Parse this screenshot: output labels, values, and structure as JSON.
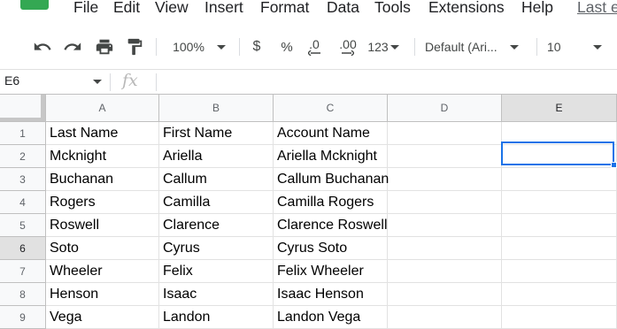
{
  "menu": {
    "items": [
      "File",
      "Edit",
      "View",
      "Insert",
      "Format",
      "Data",
      "Tools",
      "Extensions",
      "Help"
    ],
    "last_edit": "Last e"
  },
  "toolbar": {
    "zoom": "100%",
    "currency": "$",
    "percent": "%",
    "decrease_decimal": ".0",
    "increase_decimal": ".00",
    "number_format": "123",
    "font": "Default (Ari...",
    "font_size": "10"
  },
  "formula_bar": {
    "cell_ref": "E6",
    "fx": "fx",
    "value": ""
  },
  "grid": {
    "columns": [
      "A",
      "B",
      "C",
      "D",
      "E"
    ],
    "selected_column": "E",
    "selected_row": "6",
    "rows": [
      {
        "num": "1",
        "cells": [
          "Last Name",
          "First Name",
          "Account Name",
          "",
          ""
        ]
      },
      {
        "num": "2",
        "cells": [
          "Mcknight",
          "Ariella",
          "Ariella Mcknight",
          "",
          ""
        ]
      },
      {
        "num": "3",
        "cells": [
          "Buchanan",
          "Callum",
          "Callum Buchanan",
          "",
          ""
        ]
      },
      {
        "num": "4",
        "cells": [
          "Rogers",
          "Camilla",
          "Camilla Rogers",
          "",
          ""
        ]
      },
      {
        "num": "5",
        "cells": [
          "Roswell",
          "Clarence",
          "Clarence Roswell",
          "",
          ""
        ]
      },
      {
        "num": "6",
        "cells": [
          "Soto",
          "Cyrus",
          "Cyrus Soto",
          "",
          ""
        ]
      },
      {
        "num": "7",
        "cells": [
          "Wheeler",
          "Felix",
          "Felix Wheeler",
          "",
          ""
        ]
      },
      {
        "num": "8",
        "cells": [
          "Henson",
          "Isaac",
          "Isaac Henson",
          "",
          ""
        ]
      },
      {
        "num": "9",
        "cells": [
          "Vega",
          "Landon",
          "Landon Vega",
          "",
          ""
        ]
      }
    ]
  },
  "colors": {
    "accent": "#1a73e8",
    "logo": "#34a853"
  }
}
